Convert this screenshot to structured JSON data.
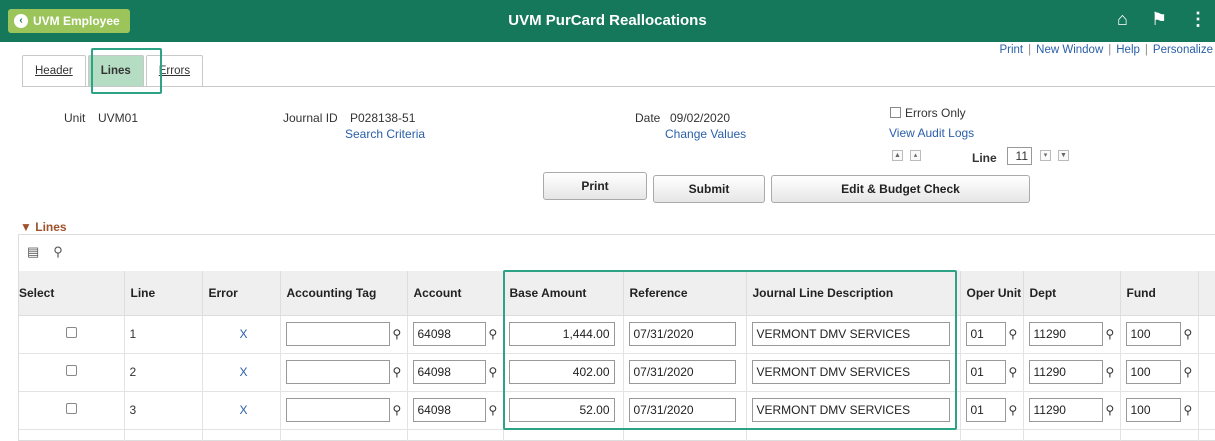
{
  "banner": {
    "back_label": "UVM Employee",
    "back_icon": "chevron-left-icon",
    "title": "UVM PurCard Reallocations",
    "icons": [
      "home-icon",
      "flag-icon",
      "more-vertical-icon"
    ],
    "color": "#15785a"
  },
  "top_links": {
    "print": "Print",
    "new_window": "New Window",
    "help": "Help",
    "personalize": "Personalize",
    "separator": "|"
  },
  "tabs": [
    {
      "label": "Header",
      "active": false
    },
    {
      "label": "Lines",
      "active": true
    },
    {
      "label": "Errors",
      "active": false
    }
  ],
  "header": {
    "unit_label": "Unit",
    "unit_value": "UVM01",
    "journal_label": "Journal ID",
    "journal_value": "P028138-51",
    "search_criteria": "Search Criteria",
    "date_label": "Date",
    "date_value": "09/02/2020",
    "change_values": "Change Values",
    "errors_only": "Errors Only",
    "view_audit_logs": "View Audit Logs",
    "line_label": "Line",
    "line_value": "11"
  },
  "buttons": {
    "print": "Print",
    "submit": "Submit",
    "edit_budget": "Edit & Budget Check"
  },
  "lines_section": {
    "title": "Lines",
    "columns": [
      "Select",
      "Line",
      "Error",
      "Accounting Tag",
      "Account",
      "Base Amount",
      "Reference",
      "Journal Line Description",
      "Oper Unit",
      "Dept",
      "Fund"
    ],
    "rows": [
      {
        "line": "1",
        "error": "X",
        "accounting_tag": "",
        "account": "64098",
        "base_amount": "1,444.00",
        "reference": "07/31/2020",
        "description": "VERMONT DMV SERVICES",
        "oper_unit": "01",
        "dept": "11290",
        "fund": "100"
      },
      {
        "line": "2",
        "error": "X",
        "accounting_tag": "",
        "account": "64098",
        "base_amount": "402.00",
        "reference": "07/31/2020",
        "description": "VERMONT DMV SERVICES",
        "oper_unit": "01",
        "dept": "11290",
        "fund": "100"
      },
      {
        "line": "3",
        "error": "X",
        "accounting_tag": "",
        "account": "64098",
        "base_amount": "52.00",
        "reference": "07/31/2020",
        "description": "VERMONT DMV SERVICES",
        "oper_unit": "01",
        "dept": "11290",
        "fund": "100"
      }
    ]
  },
  "colors": {
    "highlight": "#2da385",
    "active_tab": "#b4ddc3",
    "link": "#2a5fa8",
    "section_title": "#a0522d"
  }
}
